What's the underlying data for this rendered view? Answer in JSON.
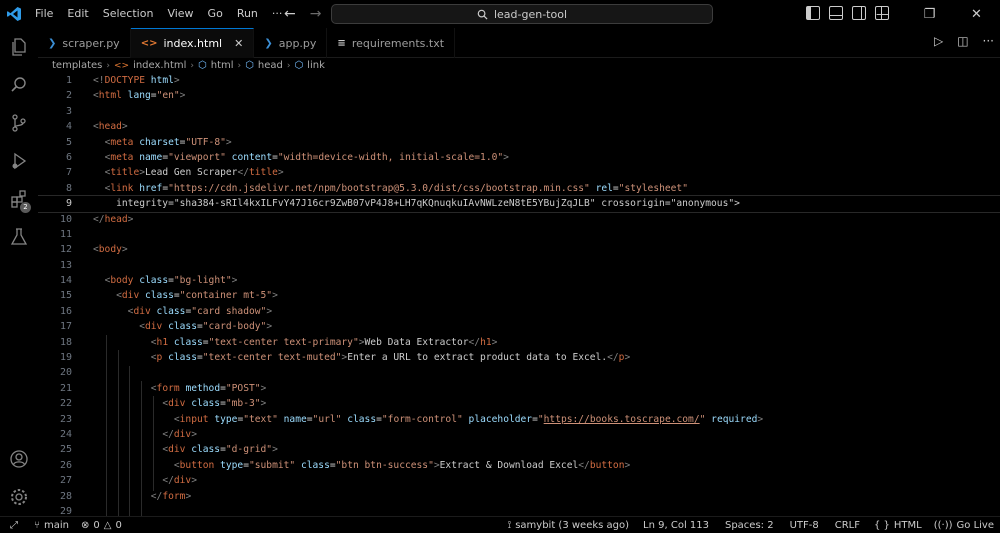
{
  "menu": [
    "File",
    "Edit",
    "Selection",
    "View",
    "Go",
    "Run"
  ],
  "search": {
    "label": "lead-gen-tool"
  },
  "colors": {
    "accent": "#0078d4",
    "tag": "#d16c42",
    "attr": "#9cdcfe",
    "string": "#ce9178",
    "bg": "#000000"
  },
  "activity_icons": [
    "files-icon",
    "search-icon",
    "source-control-icon",
    "run-debug-icon",
    "extensions-icon",
    "testing-icon",
    "account-icon",
    "settings-gear-icon"
  ],
  "extensions_badge": "2",
  "tabs": [
    {
      "label": "scraper.py",
      "icon": "python-icon",
      "active": false
    },
    {
      "label": "index.html",
      "icon": "html-icon",
      "active": true
    },
    {
      "label": "app.py",
      "icon": "python-icon",
      "active": false
    },
    {
      "label": "requirements.txt",
      "icon": "text-file-icon",
      "active": false
    }
  ],
  "breadcrumb": [
    "templates",
    "index.html",
    "html",
    "head",
    "link"
  ],
  "code": {
    "current_line": 9,
    "lines": [
      {
        "n": "1",
        "text": "<!DOCTYPE html>"
      },
      {
        "n": "2",
        "text": "<html lang=\"en\">"
      },
      {
        "n": "3",
        "text": ""
      },
      {
        "n": "4",
        "text": "<head>"
      },
      {
        "n": "5",
        "text": "  <meta charset=\"UTF-8\">"
      },
      {
        "n": "6",
        "text": "  <meta name=\"viewport\" content=\"width=device-width, initial-scale=1.0\">"
      },
      {
        "n": "7",
        "text": "  <title>Lead Gen Scraper</title>"
      },
      {
        "n": "8",
        "text": "  <link href=\"https://cdn.jsdelivr.net/npm/bootstrap@5.3.0/dist/css/bootstrap.min.css\" rel=\"stylesheet\""
      },
      {
        "n": "9",
        "text": "    integrity=\"sha384-sRIl4kxILFvY47J16cr9ZwB07vP4J8+LH7qKQnuqkuIAvNWLzeN8tE5YBujZqJLB\" crossorigin=\"anonymous\">"
      },
      {
        "n": "10",
        "text": "</head>"
      },
      {
        "n": "11",
        "text": ""
      },
      {
        "n": "12",
        "text": "<body>"
      },
      {
        "n": "13",
        "text": ""
      },
      {
        "n": "14",
        "text": "  <body class=\"bg-light\">"
      },
      {
        "n": "15",
        "text": "    <div class=\"container mt-5\">"
      },
      {
        "n": "16",
        "text": "      <div class=\"card shadow\">"
      },
      {
        "n": "17",
        "text": "        <div class=\"card-body\">"
      },
      {
        "n": "18",
        "text": "          <h1 class=\"text-center text-primary\">Web Data Extractor</h1>"
      },
      {
        "n": "19",
        "text": "          <p class=\"text-center text-muted\">Enter a URL to extract product data to Excel.</p>"
      },
      {
        "n": "20",
        "text": ""
      },
      {
        "n": "21",
        "text": "          <form method=\"POST\">"
      },
      {
        "n": "22",
        "text": "            <div class=\"mb-3\">"
      },
      {
        "n": "23",
        "text": "              <input type=\"text\" name=\"url\" class=\"form-control\" placeholder=\"https://books.toscrape.com/\" required>"
      },
      {
        "n": "24",
        "text": "            </div>"
      },
      {
        "n": "25",
        "text": "            <div class=\"d-grid\">"
      },
      {
        "n": "26",
        "text": "              <button type=\"submit\" class=\"btn btn-success\">Extract & Download Excel</button>"
      },
      {
        "n": "27",
        "text": "            </div>"
      },
      {
        "n": "28",
        "text": "          </form>"
      },
      {
        "n": "29",
        "text": ""
      }
    ]
  },
  "status": {
    "branch": "main",
    "errors": "0",
    "warnings": "0",
    "blame": "samybit (3 weeks ago)",
    "position": "Ln 9, Col 113",
    "spaces": "Spaces: 2",
    "encoding": "UTF-8",
    "eol": "CRLF",
    "language": "HTML",
    "golive": "Go Live"
  }
}
